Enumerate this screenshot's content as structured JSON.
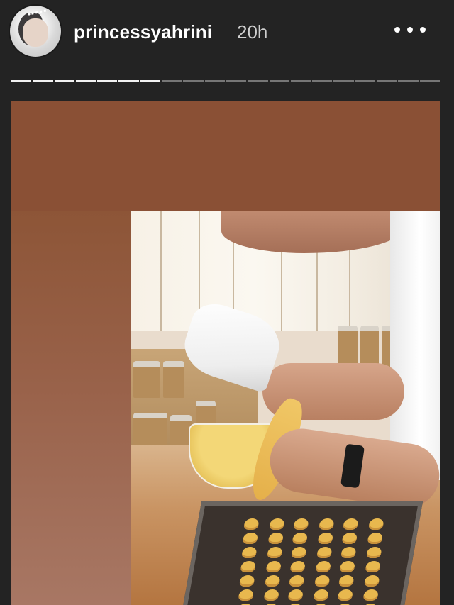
{
  "header": {
    "username": "princessyahrini",
    "time": "20h",
    "more_icon": "more-horizontal-icon"
  },
  "progress": {
    "total_segments": 20,
    "completed_segments": 7
  },
  "story": {
    "top_color": "#8a5035",
    "bottom_color": "#a97a66"
  }
}
